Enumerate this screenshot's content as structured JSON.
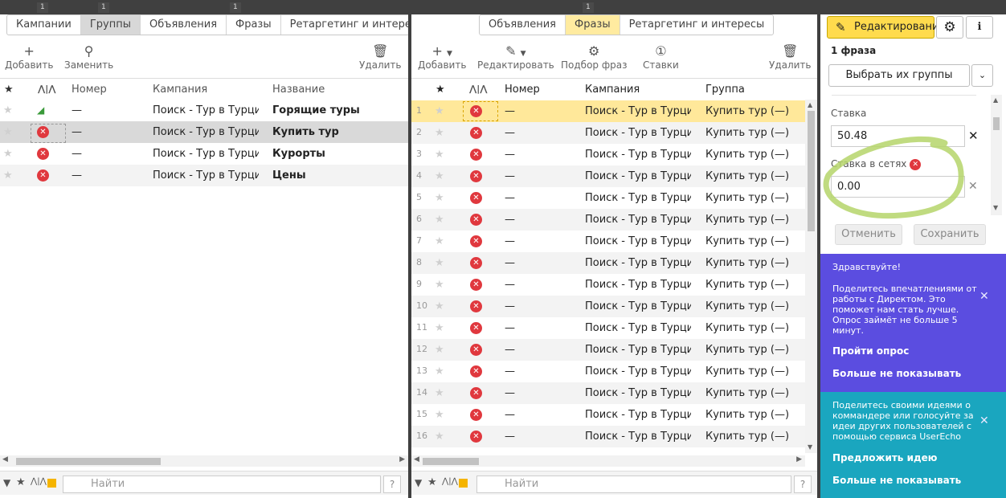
{
  "top_badges": [
    "1",
    "1",
    "1",
    "1"
  ],
  "left": {
    "tabs": [
      {
        "label": "Кампании",
        "state": "normal"
      },
      {
        "label": "Группы",
        "state": "selected"
      },
      {
        "label": "Объявления",
        "state": "normal"
      },
      {
        "label": "Фразы",
        "state": "normal"
      },
      {
        "label": "Ретаргетинг и интересы",
        "state": "normal"
      }
    ],
    "toolbar": {
      "add": "Добавить",
      "replace": "Заменить",
      "delete": "Удалить"
    },
    "columns": {
      "number": "Номер",
      "campaign": "Кампания",
      "name": "Название"
    },
    "rows": [
      {
        "status": "active",
        "number": "—",
        "campaign": "Поиск - Тур в Турцию",
        "name": "Горящие туры"
      },
      {
        "status": "stopped",
        "number": "—",
        "campaign": "Поиск - Тур в Турцию",
        "name": "Купить тур"
      },
      {
        "status": "stopped",
        "number": "—",
        "campaign": "Поиск - Тур в Турцию",
        "name": "Курорты"
      },
      {
        "status": "stopped",
        "number": "—",
        "campaign": "Поиск - Тур в Турцию",
        "name": "Цены"
      }
    ],
    "search_placeholder": "Найти",
    "help": "?"
  },
  "middle": {
    "tabs": [
      {
        "label": "Объявления",
        "state": "normal"
      },
      {
        "label": "Фразы",
        "state": "highlight"
      },
      {
        "label": "Ретаргетинг и интересы",
        "state": "normal"
      }
    ],
    "toolbar": {
      "add": "Добавить",
      "edit": "Редактировать",
      "pick": "Подбор фраз",
      "bids": "Ставки",
      "delete": "Удалить"
    },
    "columns": {
      "number": "Номер",
      "campaign": "Кампания",
      "group": "Группа"
    },
    "rows": [
      {
        "n": "1",
        "number": "—",
        "campaign": "Поиск - Тур в Турцию",
        "group": "Купить тур (—)"
      },
      {
        "n": "2",
        "number": "—",
        "campaign": "Поиск - Тур в Турцию",
        "group": "Купить тур (—)"
      },
      {
        "n": "3",
        "number": "—",
        "campaign": "Поиск - Тур в Турцию",
        "group": "Купить тур (—)"
      },
      {
        "n": "4",
        "number": "—",
        "campaign": "Поиск - Тур в Турцию",
        "group": "Купить тур (—)"
      },
      {
        "n": "5",
        "number": "—",
        "campaign": "Поиск - Тур в Турцию",
        "group": "Купить тур (—)"
      },
      {
        "n": "6",
        "number": "—",
        "campaign": "Поиск - Тур в Турцию",
        "group": "Купить тур (—)"
      },
      {
        "n": "7",
        "number": "—",
        "campaign": "Поиск - Тур в Турцию",
        "group": "Купить тур (—)"
      },
      {
        "n": "8",
        "number": "—",
        "campaign": "Поиск - Тур в Турцию",
        "group": "Купить тур (—)"
      },
      {
        "n": "9",
        "number": "—",
        "campaign": "Поиск - Тур в Турцию",
        "group": "Купить тур (—)"
      },
      {
        "n": "10",
        "number": "—",
        "campaign": "Поиск - Тур в Турцию",
        "group": "Купить тур (—)"
      },
      {
        "n": "11",
        "number": "—",
        "campaign": "Поиск - Тур в Турцию",
        "group": "Купить тур (—)"
      },
      {
        "n": "12",
        "number": "—",
        "campaign": "Поиск - Тур в Турцию",
        "group": "Купить тур (—)"
      },
      {
        "n": "13",
        "number": "—",
        "campaign": "Поиск - Тур в Турцию",
        "group": "Купить тур (—)"
      },
      {
        "n": "14",
        "number": "—",
        "campaign": "Поиск - Тур в Турцию",
        "group": "Купить тур (—)"
      },
      {
        "n": "15",
        "number": "—",
        "campaign": "Поиск - Тур в Турцию",
        "group": "Купить тур (—)"
      },
      {
        "n": "16",
        "number": "—",
        "campaign": "Поиск - Тур в Турцию",
        "group": "Купить тур (—)"
      }
    ],
    "search_placeholder": "Найти",
    "help": "?"
  },
  "right": {
    "edit_button": "Редактирование",
    "count": "1 фраза",
    "select_groups": "Выбрать их группы",
    "bid_label": "Ставка",
    "bid_value": "50.48",
    "net_bid_label": "Ставка в сетях",
    "net_bid_value": "0.00",
    "cancel": "Отменить",
    "save": "Сохранить",
    "survey": {
      "greeting": "Здравствуйте!",
      "text": "Поделитесь впечатлениями от работы с Директом. Это поможет нам стать лучше. Опрос займёт не больше 5 минут.",
      "take": "Пройти опрос",
      "hide": "Больше не показывать"
    },
    "idea": {
      "text": "Поделитесь своими идеями о коммандере или голосуйте за идеи других пользователей с помощью сервиса UserEcho",
      "suggest": "Предложить идею",
      "hide": "Больше не показывать"
    },
    "colors": {
      "accent": "#ffdb4d",
      "purple": "#5b4de0",
      "teal": "#1aa6bf",
      "highlight_stroke": "#b5d56a"
    }
  }
}
